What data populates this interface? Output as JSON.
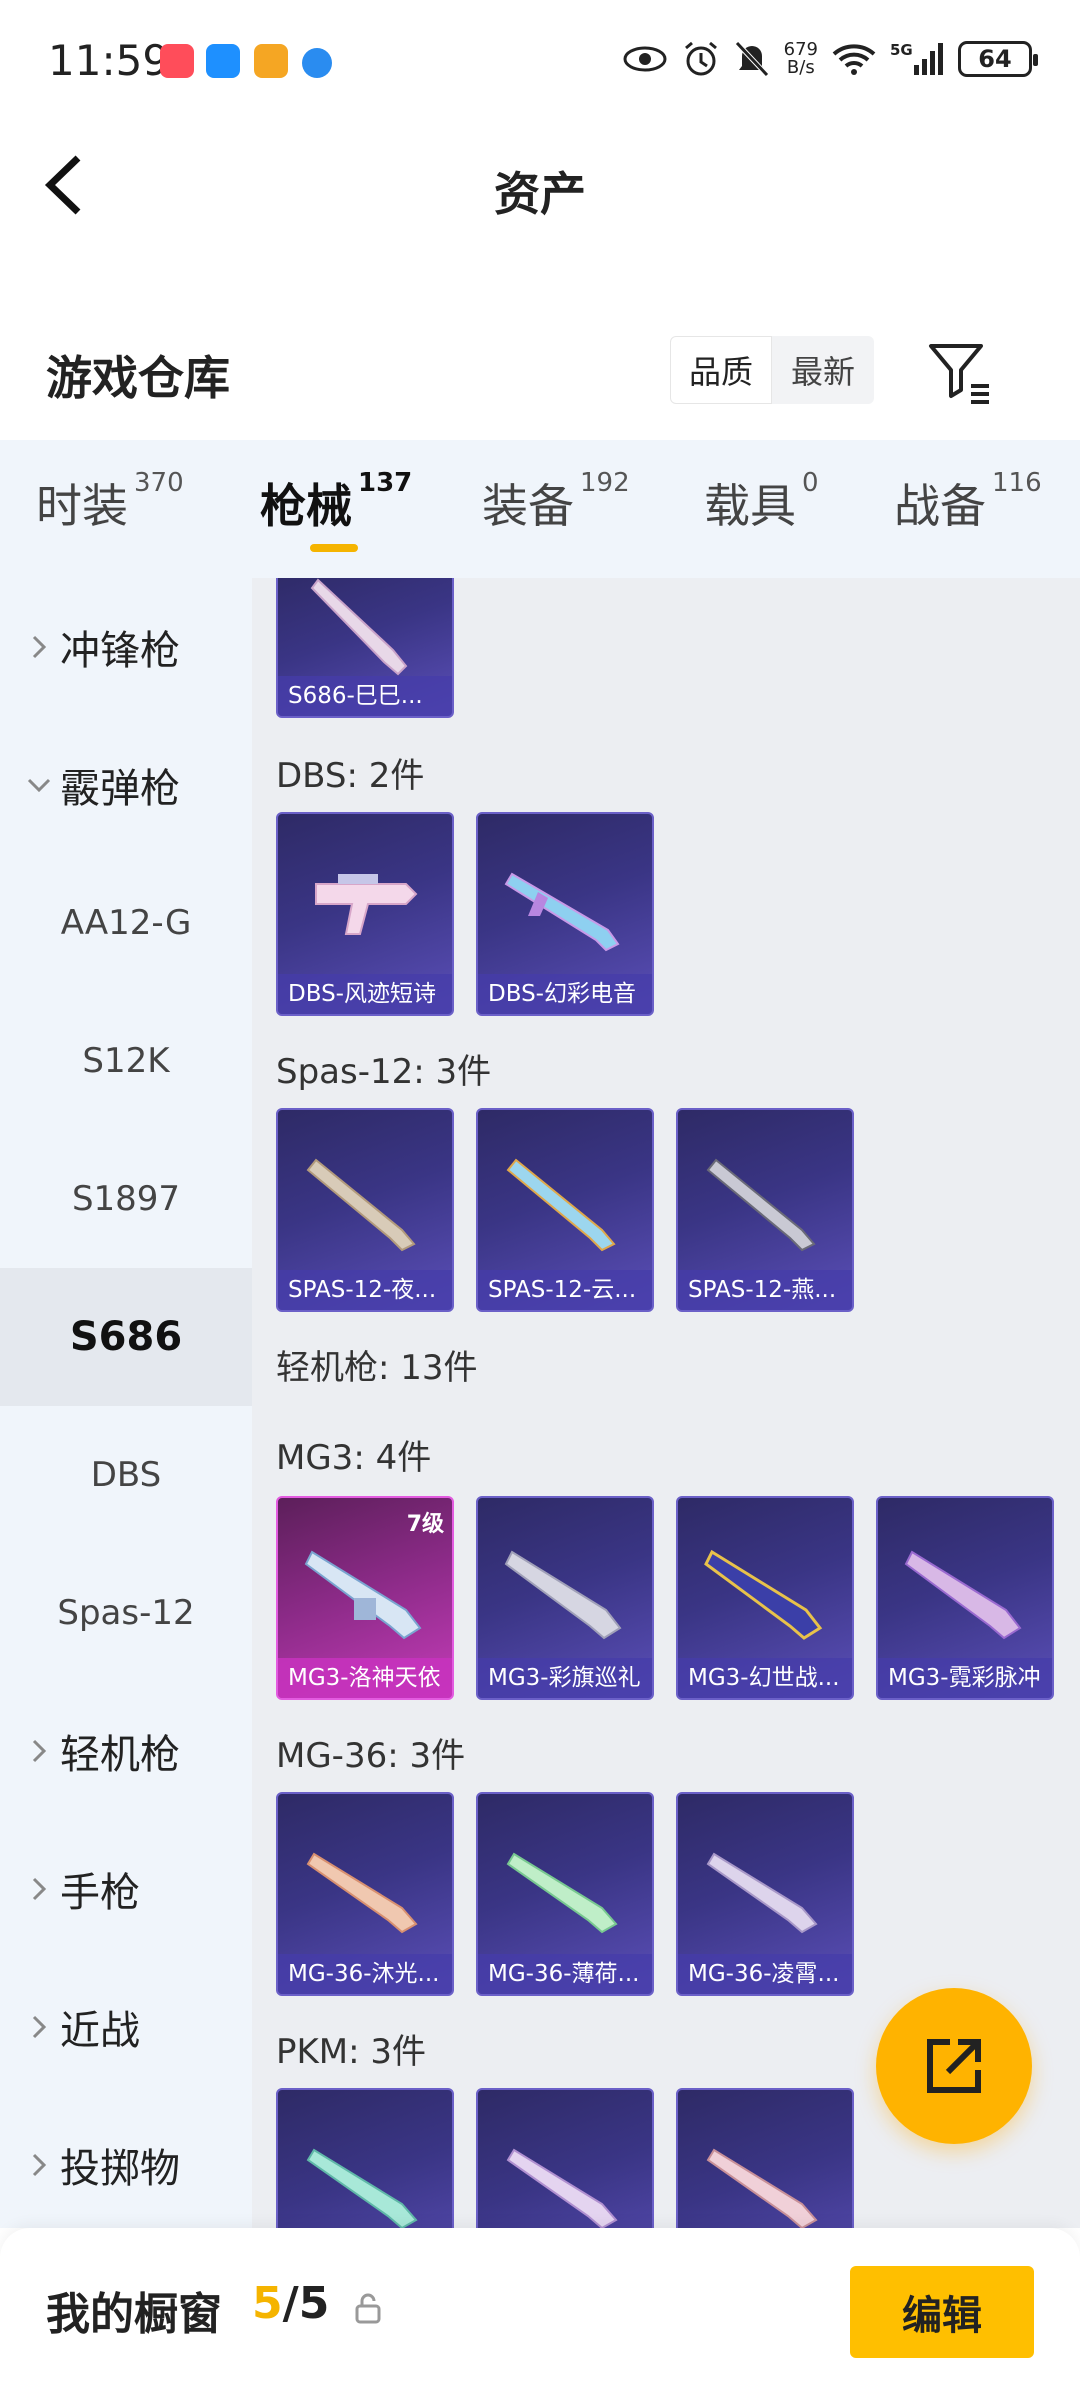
{
  "status": {
    "time": "11:59",
    "netspeed": "679\nB/s",
    "network": "5G",
    "battery": "64"
  },
  "header": {
    "title": "资产"
  },
  "section": {
    "title": "游戏仓库",
    "sort_quality": "品质",
    "sort_newest": "最新"
  },
  "tabs": [
    {
      "label": "时装",
      "count": "370"
    },
    {
      "label": "枪械",
      "count": "137"
    },
    {
      "label": "装备",
      "count": "192"
    },
    {
      "label": "载具",
      "count": "0"
    },
    {
      "label": "战备",
      "count": "116"
    }
  ],
  "sidebar": {
    "items": [
      {
        "label": "冲锋枪"
      },
      {
        "label": "霰弹枪"
      },
      {
        "label": "AA12-G"
      },
      {
        "label": "S12K"
      },
      {
        "label": "S1897"
      },
      {
        "label": "S686"
      },
      {
        "label": "DBS"
      },
      {
        "label": "Spas-12"
      },
      {
        "label": "轻机枪"
      },
      {
        "label": "手枪"
      },
      {
        "label": "近战"
      },
      {
        "label": "投掷物"
      }
    ]
  },
  "content": {
    "groups": {
      "dbs": "DBS: 2件",
      "spas": "Spas-12: 3件",
      "lmg": "轻机枪: 13件",
      "mg3": "MG3: 4件",
      "mg36": "MG-36: 3件",
      "pkm": "PKM: 3件"
    },
    "cards": {
      "s686_1": "S686-巳巳...",
      "dbs_1": "DBS-风迹短诗",
      "dbs_2": "DBS-幻彩电音",
      "spas_1": "SPAS-12-夜...",
      "spas_2": "SPAS-12-云...",
      "spas_3": "SPAS-12-燕...",
      "mg3_1": "MG3-洛神天依",
      "mg3_1_level": "7级",
      "mg3_2": "MG3-彩旗巡礼",
      "mg3_3": "MG3-幻世战...",
      "mg3_4": "MG3-霓彩脉冲",
      "mg36_1": "MG-36-沐光...",
      "mg36_2": "MG-36-薄荷...",
      "mg36_3": "MG-36-凌霄..."
    }
  },
  "bottom": {
    "label": "我的橱窗",
    "current": "5",
    "total": "/5",
    "edit": "编辑"
  },
  "colors": {
    "accent": "#f5b400",
    "card_purple": "#3a3585",
    "card_pink": "#c43cb8"
  }
}
